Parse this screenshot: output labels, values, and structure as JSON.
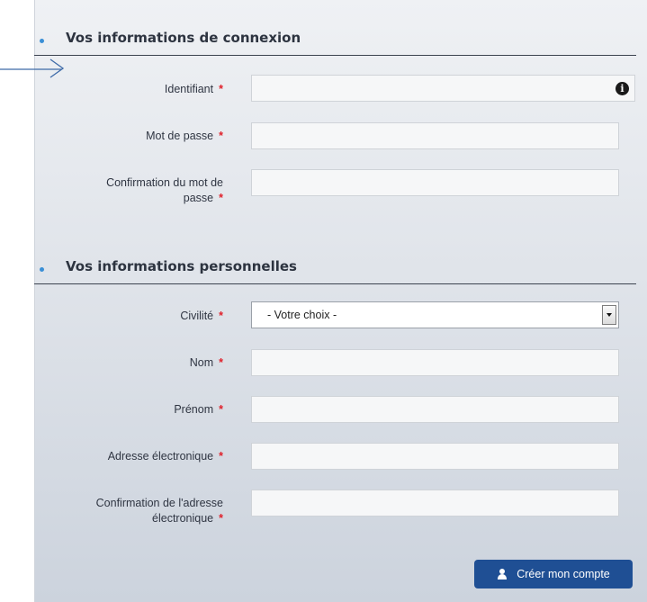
{
  "connexion": {
    "title": "Vos informations de connexion",
    "identifiant_label": "Identifiant",
    "password_label": "Mot de passe",
    "confirm_password_label_line1": "Confirmation du mot de",
    "confirm_password_label_line2": "passe"
  },
  "personnel": {
    "title": "Vos informations personnelles",
    "civilite_label": "Civilité",
    "civilite_selected": "- Votre choix -",
    "nom_label": "Nom",
    "prenom_label": "Prénom",
    "email_label": "Adresse électronique",
    "confirm_email_label_line1": "Confirmation de l'adresse",
    "confirm_email_label_line2": "électronique"
  },
  "required_mark": "*",
  "info_glyph": "i",
  "submit_label": "Créer mon compte",
  "icons": [
    "info-icon",
    "chevron-down-icon",
    "user-icon",
    "arrow-right-icon"
  ],
  "colors": {
    "accent": "#1f4f94",
    "required": "#e0202a",
    "bullet": "#3a8fd6"
  }
}
